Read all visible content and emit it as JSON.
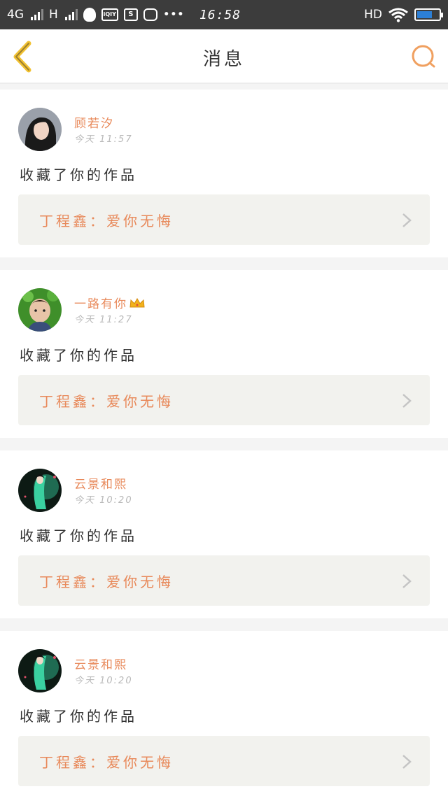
{
  "status_bar": {
    "network_1": "4G",
    "network_2": "H",
    "icons": [
      "qq-icon",
      "iqiyi-icon",
      "s-app-icon",
      "database-app-icon",
      "more-icon"
    ],
    "iqiyi_label": "iQIY",
    "s_label": "S",
    "more": "•••",
    "time": "16:58",
    "hd": "HD",
    "battery_level": 0.7
  },
  "header": {
    "title": "消息",
    "back_icon": "chevron-left-icon",
    "search_icon": "search-icon",
    "accent_color": "#f0a060",
    "back_color": "#f2c233"
  },
  "messages": [
    {
      "username": "顾若汐",
      "time": "今天 11:57",
      "action": "收藏了你的作品",
      "work": "丁程鑫：爱你无悔",
      "crown": false
    },
    {
      "username": "一路有你",
      "time": "今天 11:27",
      "action": "收藏了你的作品",
      "work": "丁程鑫：爱你无悔",
      "crown": true
    },
    {
      "username": "云景和熙",
      "time": "今天 10:20",
      "action": "收藏了你的作品",
      "work": "丁程鑫：爱你无悔",
      "crown": false
    },
    {
      "username": "云景和熙",
      "time": "今天 10:20",
      "action": "收藏了你的作品",
      "work": "丁程鑫：爱你无悔",
      "crown": false
    }
  ],
  "colors": {
    "username": "#e8895a",
    "work_text": "#e8895a",
    "work_bg": "#f2f2ee",
    "status_bar": "#3c3c3c"
  }
}
